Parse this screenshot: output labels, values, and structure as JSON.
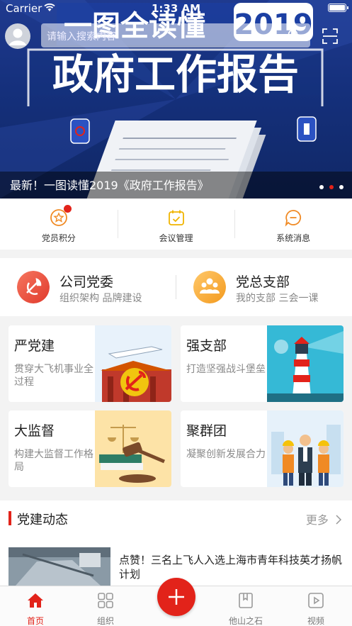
{
  "status_bar": {
    "carrier": "Carrier",
    "time": "1:33 AM"
  },
  "header": {
    "search_placeholder": "请输入搜索内容"
  },
  "banner": {
    "caption": "最新！一图读懂2019《政府工作报告》",
    "art_line1": "一图全读懂",
    "art_year": "2019",
    "art_line2": "政府工作报告",
    "slide_count": 3,
    "active_slide": 2
  },
  "shortcuts": [
    {
      "label": "党员积分",
      "icon": "star-badge-icon",
      "has_badge": true
    },
    {
      "label": "会议管理",
      "icon": "calendar-icon",
      "has_badge": false
    },
    {
      "label": "系统消息",
      "icon": "message-icon",
      "has_badge": false
    }
  ],
  "org": [
    {
      "title": "公司党委",
      "subtitle": "组织架构 品牌建设",
      "icon": "party-emblem-icon",
      "color": "#e84b3c"
    },
    {
      "title": "党总支部",
      "subtitle": "我的支部  三会一课",
      "icon": "group-icon",
      "color": "#f5a623"
    }
  ],
  "cards": [
    {
      "title": "严党建",
      "desc": "贯穿大飞机事业全过程",
      "image": "party-building-image"
    },
    {
      "title": "强支部",
      "desc": "打造坚强战斗堡垒",
      "image": "lighthouse-image"
    },
    {
      "title": "大监督",
      "desc": "构建大监督工作格局",
      "image": "justice-gavel-image"
    },
    {
      "title": "聚群团",
      "desc": "凝聚创新发展合力",
      "image": "workers-team-image"
    }
  ],
  "news": {
    "section_title": "党建动态",
    "more_label": "更多",
    "items": [
      {
        "title": "点赞！三名上飞人入选上海市青年科技英才扬帆计划"
      }
    ]
  },
  "tab_bar": {
    "tabs": [
      {
        "label": "首页",
        "icon": "home-icon",
        "active": true
      },
      {
        "label": "组织",
        "icon": "grid-icon",
        "active": false
      },
      {
        "label": "他山之石",
        "icon": "book-icon",
        "active": false
      },
      {
        "label": "视频",
        "icon": "video-icon",
        "active": false
      }
    ],
    "fab_icon": "plus-icon"
  },
  "colors": {
    "accent": "#e2231a",
    "banner_bg": "#1a3584",
    "party_orange": "#f5a623"
  }
}
